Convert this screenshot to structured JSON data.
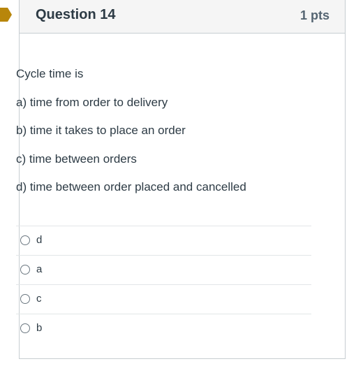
{
  "question": {
    "title": "Question 14",
    "points": "1 pts",
    "text_lines": [
      "Cycle time is",
      "a) time from order to delivery",
      "b) time it takes to place an order",
      "c) time between orders",
      "d) time between order placed and cancelled"
    ],
    "answers": [
      {
        "label": "d",
        "selected": false
      },
      {
        "label": "a",
        "selected": false
      },
      {
        "label": "c",
        "selected": false
      },
      {
        "label": "b",
        "selected": false
      }
    ]
  },
  "colors": {
    "flag": "#b8860b",
    "header_bg": "#f5f5f5",
    "border": "#c7cdd1",
    "text": "#2d3b45"
  },
  "icons": {
    "flag": "bookmark-flag-icon",
    "radio": "radio-button-icon"
  }
}
